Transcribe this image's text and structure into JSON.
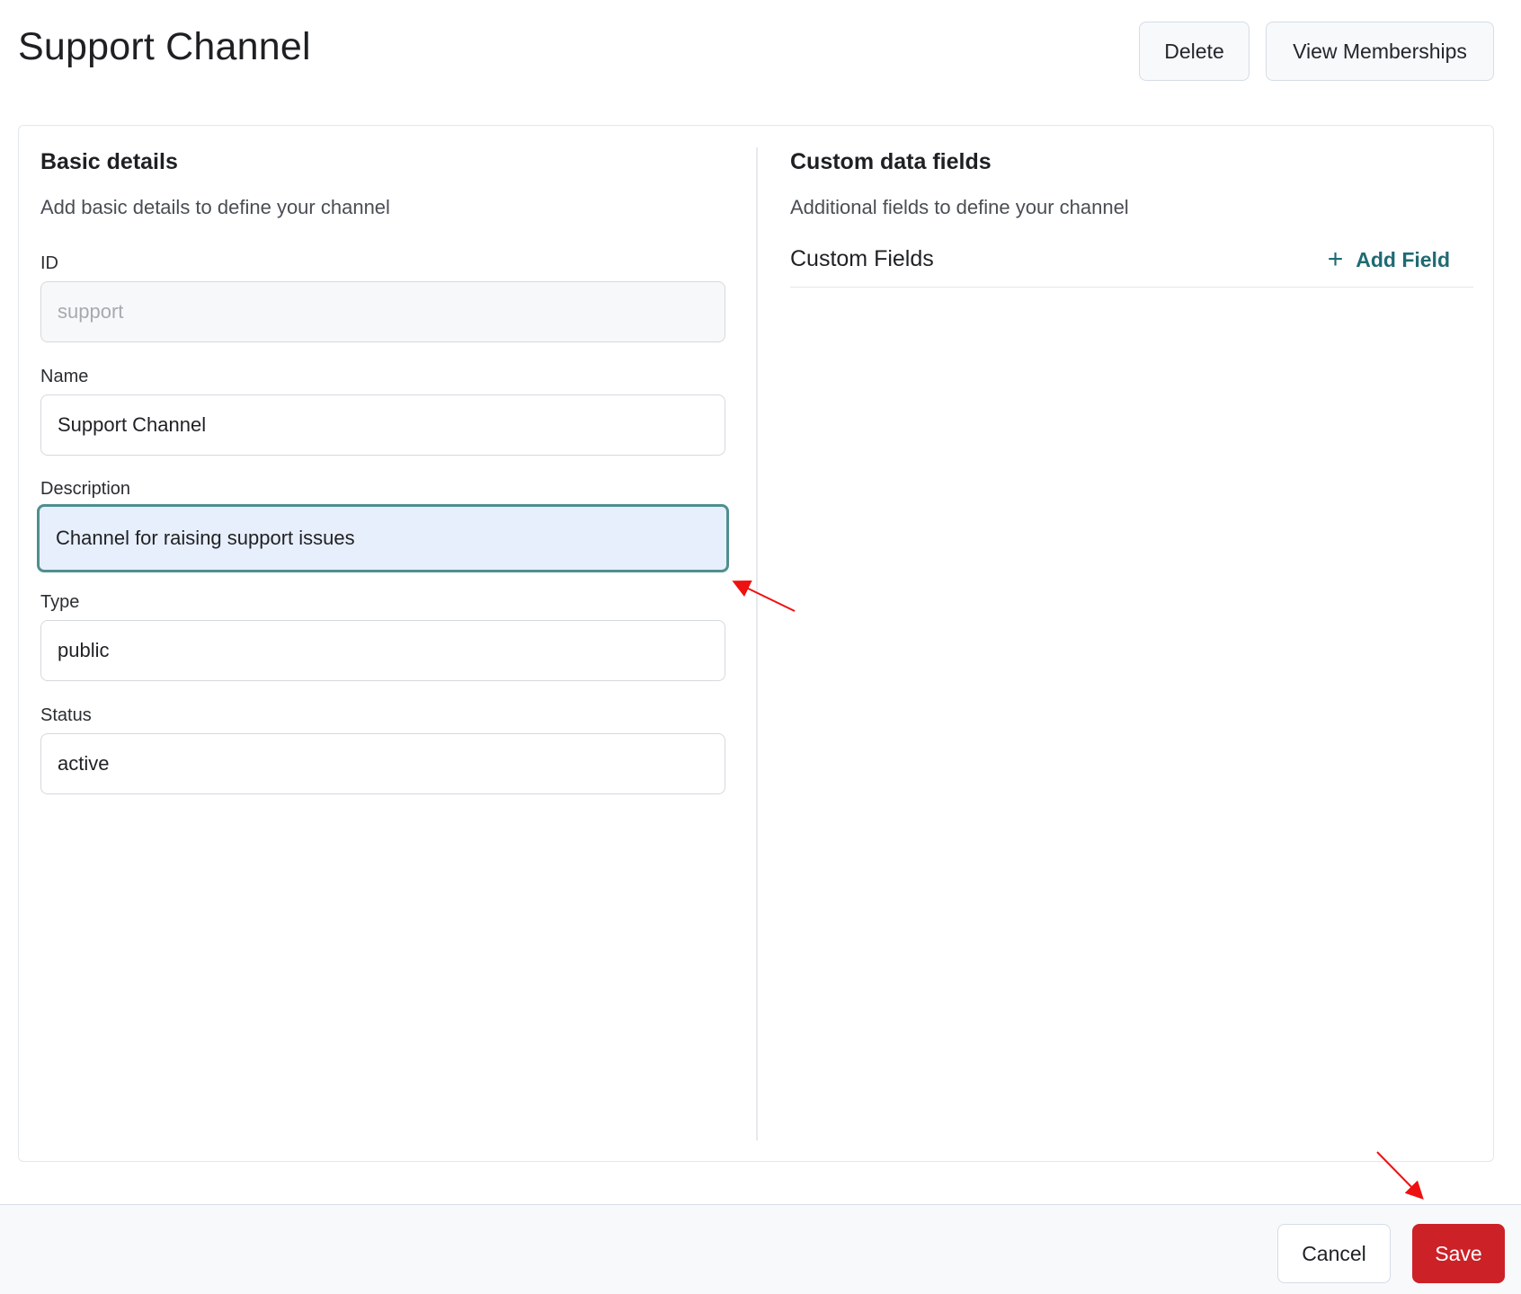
{
  "header": {
    "title": "Support Channel",
    "delete_label": "Delete",
    "view_memberships_label": "View Memberships"
  },
  "basic_details": {
    "title": "Basic details",
    "subtitle": "Add basic details to define your channel",
    "fields": [
      {
        "label": "ID",
        "value": "support",
        "disabled": true
      },
      {
        "label": "Name",
        "value": "Support Channel"
      },
      {
        "label": "Description",
        "value": "Channel for raising support issues",
        "focused": true
      },
      {
        "label": "Type",
        "value": "public"
      },
      {
        "label": "Status",
        "value": "active"
      }
    ]
  },
  "custom_data": {
    "title": "Custom data fields",
    "subtitle": "Additional fields to define your channel",
    "section_label": "Custom Fields",
    "add_field_label": "Add Field",
    "add_field_icon": "plus-icon"
  },
  "footer": {
    "cancel_label": "Cancel",
    "save_label": "Save"
  },
  "colors": {
    "accent": "#1f6b72",
    "focus_border": "#4f8f8f",
    "save": "#cc2127",
    "annotation_arrow": "#ee1111"
  }
}
